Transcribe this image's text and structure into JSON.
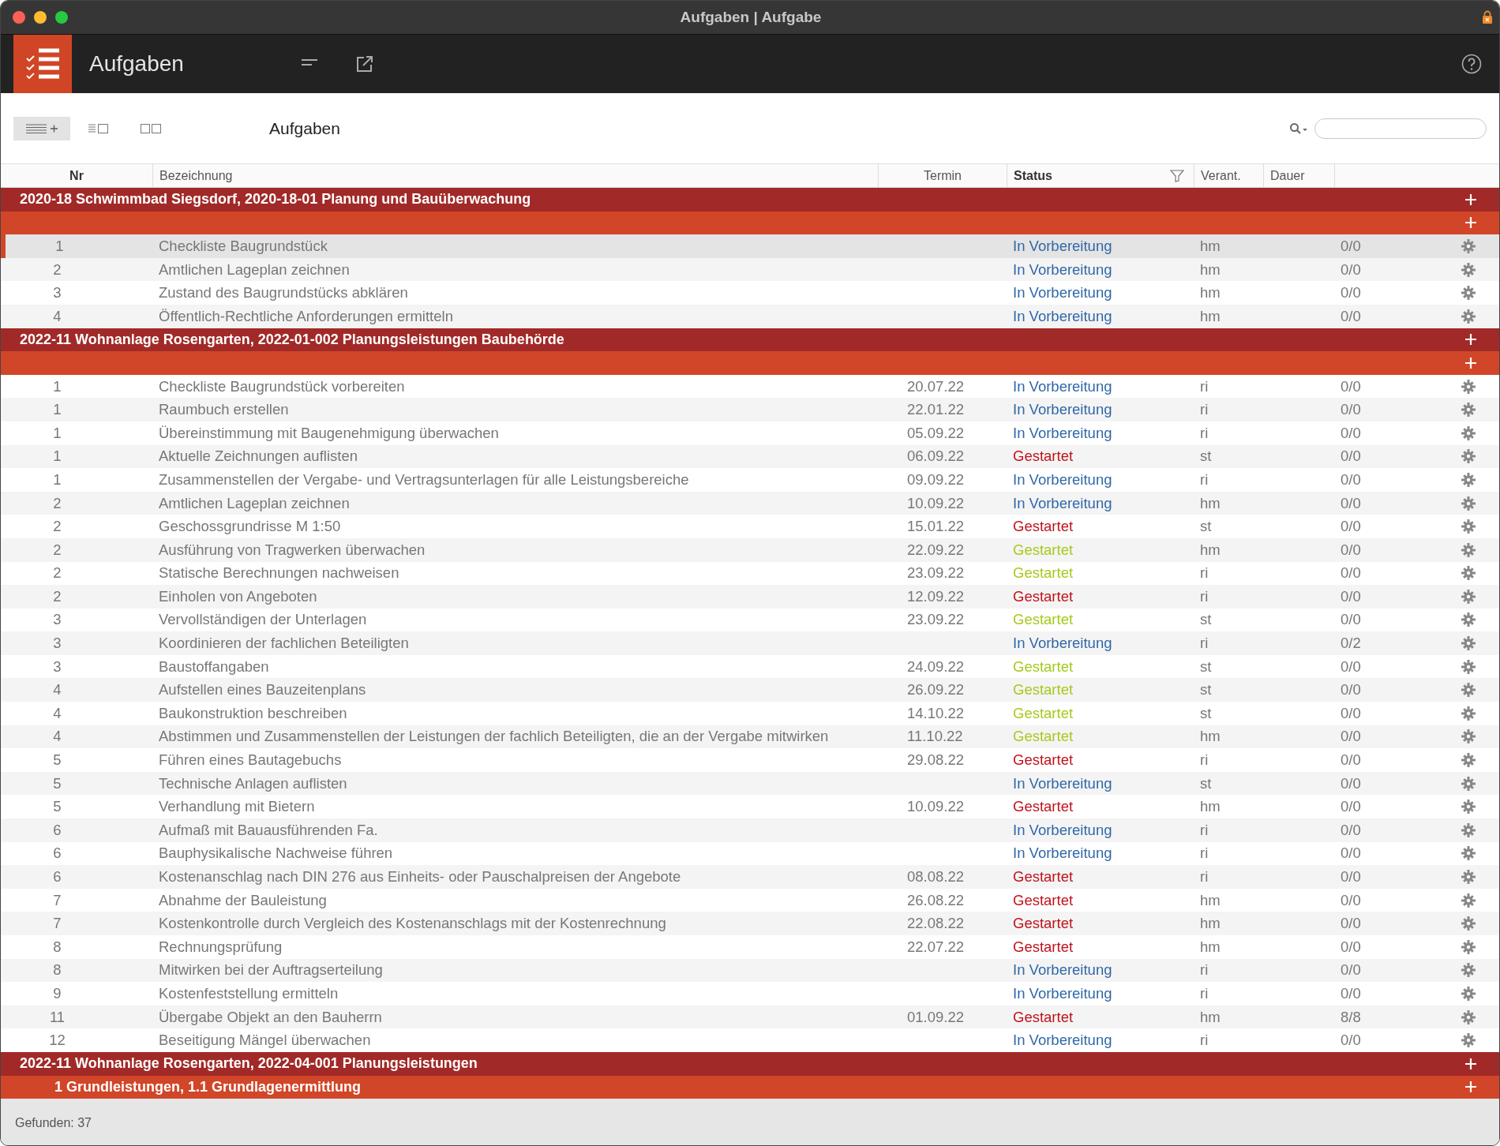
{
  "window": {
    "title": "Aufgaben | Aufgabe"
  },
  "app_header": {
    "title": "Aufgaben"
  },
  "toolbar": {
    "title": "Aufgaben"
  },
  "table": {
    "columns": [
      {
        "label": "Nr",
        "bold": true,
        "filter": false
      },
      {
        "label": "Bezeichnung",
        "bold": false,
        "filter": false
      },
      {
        "label": "Termin",
        "bold": false,
        "filter": false
      },
      {
        "label": "Status",
        "bold": true,
        "filter": true
      },
      {
        "label": "Verant.",
        "bold": false,
        "filter": false
      },
      {
        "label": "Dauer",
        "bold": false,
        "filter": false
      }
    ],
    "groups": [
      {
        "title": "2020-18 Schwimmbad Siegsdorf, 2020-18-01 Planung und Bauüberwachung",
        "subgroups": [
          {
            "rows": [
              {
                "nr": "1",
                "name": "Checkliste Baugrundstück",
                "date": "",
                "status": "In Vorbereitung",
                "color": "#2f67a8",
                "owner": "hm",
                "duration": "0/0",
                "selected": true
              },
              {
                "nr": "2",
                "name": "Amtlichen Lageplan zeichnen",
                "date": "",
                "status": "In Vorbereitung",
                "color": "#2f67a8",
                "owner": "hm",
                "duration": "0/0",
                "selected": false
              },
              {
                "nr": "3",
                "name": "Zustand des Baugrundstücks abklären",
                "date": "",
                "status": "In Vorbereitung",
                "color": "#2f67a8",
                "owner": "hm",
                "duration": "0/0",
                "selected": false
              },
              {
                "nr": "4",
                "name": "Öffentlich-Rechtliche Anforderungen ermitteln",
                "date": "",
                "status": "In Vorbereitung",
                "color": "#2f67a8",
                "owner": "hm",
                "duration": "0/0",
                "selected": false
              }
            ]
          }
        ]
      },
      {
        "title": "2022-11 Wohnanlage Rosengarten, 2022-01-002 Planungsleistungen Baubehörde",
        "subgroups": [
          {
            "rows": [
              {
                "nr": "1",
                "name": "Checkliste Baugrundstück vorbereiten",
                "date": "20.07.22",
                "status": "In Vorbereitung",
                "color": "#2f67a8",
                "owner": "ri",
                "duration": "0/0",
                "selected": false
              },
              {
                "nr": "1",
                "name": "Raumbuch erstellen",
                "date": "22.01.22",
                "status": "In Vorbereitung",
                "color": "#2f67a8",
                "owner": "ri",
                "duration": "0/0",
                "selected": false
              },
              {
                "nr": "1",
                "name": "Übereinstimmung mit Baugenehmigung überwachen",
                "date": "05.09.22",
                "status": "In Vorbereitung",
                "color": "#2f67a8",
                "owner": "ri",
                "duration": "0/0",
                "selected": false
              },
              {
                "nr": "1",
                "name": "Aktuelle Zeichnungen auflisten",
                "date": "06.09.22",
                "status": "Gestartet",
                "color": "#c0121c",
                "owner": "st",
                "duration": "0/0",
                "selected": false
              },
              {
                "nr": "1",
                "name": "Zusammenstellen der Vergabe- und Vertragsunterlagen für alle Leistungsbereiche",
                "date": "09.09.22",
                "status": "In Vorbereitung",
                "color": "#2f67a8",
                "owner": "ri",
                "duration": "0/0",
                "selected": false
              },
              {
                "nr": "2",
                "name": "Amtlichen Lageplan zeichnen",
                "date": "10.09.22",
                "status": "In Vorbereitung",
                "color": "#2f67a8",
                "owner": "hm",
                "duration": "0/0",
                "selected": false
              },
              {
                "nr": "2",
                "name": "Geschossgrundrisse M 1:50",
                "date": "15.01.22",
                "status": "Gestartet",
                "color": "#c0121c",
                "owner": "st",
                "duration": "0/0",
                "selected": false
              },
              {
                "nr": "2",
                "name": "Ausführung von Tragwerken überwachen",
                "date": "22.09.22",
                "status": "Gestartet",
                "color": "#a6c91c",
                "owner": "hm",
                "duration": "0/0",
                "selected": false
              },
              {
                "nr": "2",
                "name": "Statische Berechnungen nachweisen",
                "date": "23.09.22",
                "status": "Gestartet",
                "color": "#a6c91c",
                "owner": "ri",
                "duration": "0/0",
                "selected": false
              },
              {
                "nr": "2",
                "name": "Einholen von Angeboten",
                "date": "12.09.22",
                "status": "Gestartet",
                "color": "#c0121c",
                "owner": "ri",
                "duration": "0/0",
                "selected": false
              },
              {
                "nr": "3",
                "name": "Vervollständigen der Unterlagen",
                "date": "23.09.22",
                "status": "Gestartet",
                "color": "#a6c91c",
                "owner": "st",
                "duration": "0/0",
                "selected": false
              },
              {
                "nr": "3",
                "name": "Koordinieren der fachlichen Beteiligten",
                "date": "",
                "status": "In Vorbereitung",
                "color": "#2f67a8",
                "owner": "ri",
                "duration": "0/2",
                "selected": false
              },
              {
                "nr": "3",
                "name": "Baustoffangaben",
                "date": "24.09.22",
                "status": "Gestartet",
                "color": "#a6c91c",
                "owner": "st",
                "duration": "0/0",
                "selected": false
              },
              {
                "nr": "4",
                "name": "Aufstellen eines Bauzeitenplans",
                "date": "26.09.22",
                "status": "Gestartet",
                "color": "#a6c91c",
                "owner": "st",
                "duration": "0/0",
                "selected": false
              },
              {
                "nr": "4",
                "name": "Baukonstruktion beschreiben",
                "date": "14.10.22",
                "status": "Gestartet",
                "color": "#a6c91c",
                "owner": "st",
                "duration": "0/0",
                "selected": false
              },
              {
                "nr": "4",
                "name": "Abstimmen und Zusammenstellen der Leistungen der fachlich Beteiligten, die an der Vergabe mitwirken",
                "date": "11.10.22",
                "status": "Gestartet",
                "color": "#a6c91c",
                "owner": "hm",
                "duration": "0/0",
                "selected": false
              },
              {
                "nr": "5",
                "name": "Führen eines Bautagebuchs",
                "date": "29.08.22",
                "status": "Gestartet",
                "color": "#c0121c",
                "owner": "ri",
                "duration": "0/0",
                "selected": false
              },
              {
                "nr": "5",
                "name": "Technische Anlagen auflisten",
                "date": "",
                "status": "In Vorbereitung",
                "color": "#2f67a8",
                "owner": "st",
                "duration": "0/0",
                "selected": false
              },
              {
                "nr": "5",
                "name": "Verhandlung mit Bietern",
                "date": "10.09.22",
                "status": "Gestartet",
                "color": "#c0121c",
                "owner": "hm",
                "duration": "0/0",
                "selected": false
              },
              {
                "nr": "6",
                "name": "Aufmaß mit Bauausführenden Fa.",
                "date": "",
                "status": "In Vorbereitung",
                "color": "#2f67a8",
                "owner": "ri",
                "duration": "0/0",
                "selected": false
              },
              {
                "nr": "6",
                "name": "Bauphysikalische Nachweise führen",
                "date": "",
                "status": "In Vorbereitung",
                "color": "#2f67a8",
                "owner": "ri",
                "duration": "0/0",
                "selected": false
              },
              {
                "nr": "6",
                "name": "Kostenanschlag nach DIN 276 aus Einheits- oder Pauschalpreisen der Angebote",
                "date": "08.08.22",
                "status": "Gestartet",
                "color": "#c0121c",
                "owner": "ri",
                "duration": "0/0",
                "selected": false
              },
              {
                "nr": "7",
                "name": "Abnahme der Bauleistung",
                "date": "26.08.22",
                "status": "Gestartet",
                "color": "#c0121c",
                "owner": "hm",
                "duration": "0/0",
                "selected": false
              },
              {
                "nr": "7",
                "name": "Kostenkontrolle durch Vergleich des Kostenanschlags mit der Kostenrechnung",
                "date": "22.08.22",
                "status": "Gestartet",
                "color": "#c0121c",
                "owner": "hm",
                "duration": "0/0",
                "selected": false
              },
              {
                "nr": "8",
                "name": "Rechnungsprüfung",
                "date": "22.07.22",
                "status": "Gestartet",
                "color": "#c0121c",
                "owner": "hm",
                "duration": "0/0",
                "selected": false
              },
              {
                "nr": "8",
                "name": "Mitwirken bei der Auftragserteilung",
                "date": "",
                "status": "In Vorbereitung",
                "color": "#2f67a8",
                "owner": "ri",
                "duration": "0/0",
                "selected": false
              },
              {
                "nr": "9",
                "name": "Kostenfeststellung ermitteln",
                "date": "",
                "status": "In Vorbereitung",
                "color": "#2f67a8",
                "owner": "ri",
                "duration": "0/0",
                "selected": false
              },
              {
                "nr": "11",
                "name": "Übergabe Objekt an den Bauherrn",
                "date": "01.09.22",
                "status": "Gestartet",
                "color": "#c0121c",
                "owner": "hm",
                "duration": "8/8",
                "selected": false
              },
              {
                "nr": "12",
                "name": "Beseitigung Mängel überwachen",
                "date": "",
                "status": "In Vorbereitung",
                "color": "#2f67a8",
                "owner": "ri",
                "duration": "0/0",
                "selected": false
              }
            ]
          }
        ]
      },
      {
        "title": "2022-11 Wohnanlage Rosengarten, 2022-04-001 Planungsleistungen",
        "subgroups": [
          {
            "title": "1 Grundleistungen, 1.1 Grundlagenermittlung"
          }
        ]
      }
    ]
  },
  "status_bar": {
    "text": "Gefunden: 37"
  }
}
